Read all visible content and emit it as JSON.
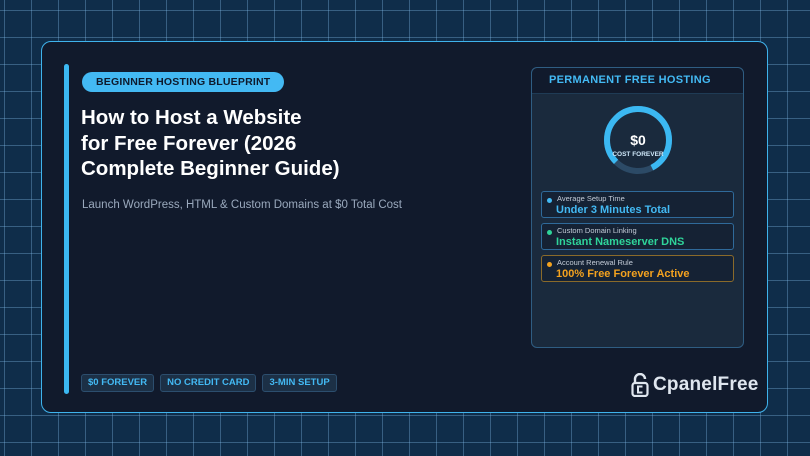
{
  "hero": {
    "badge": "BEGINNER HOSTING BLUEPRINT",
    "title_lines": [
      "How to Host a Website",
      "for Free Forever (2026",
      "Complete Beginner Guide)"
    ],
    "subtitle": "Launch WordPress, HTML & Custom Domains at $0 Total Cost"
  },
  "tags": [
    "$0 FOREVER",
    "NO CREDIT CARD",
    "3-MIN SETUP"
  ],
  "panel": {
    "header": "PERMANENT FREE HOSTING",
    "gauge": {
      "value": "$0",
      "label": "COST FOREVER",
      "fill_fraction": 0.8
    },
    "stats": [
      {
        "label": "Average Setup Time",
        "value": "Under 3 Minutes Total",
        "color": "#43b9f3"
      },
      {
        "label": "Custom Domain Linking",
        "value": "Instant Nameserver DNS",
        "color": "#2fd49a"
      },
      {
        "label": "Account Renewal Rule",
        "value": "100% Free Forever Active",
        "color": "#f3a21f"
      }
    ]
  },
  "brand": {
    "name": "CpanelFree",
    "icon": "padlock-c-icon"
  },
  "colors": {
    "accent": "#43b9f3",
    "background": "#111a2c",
    "grid": "#0f2d4a"
  }
}
